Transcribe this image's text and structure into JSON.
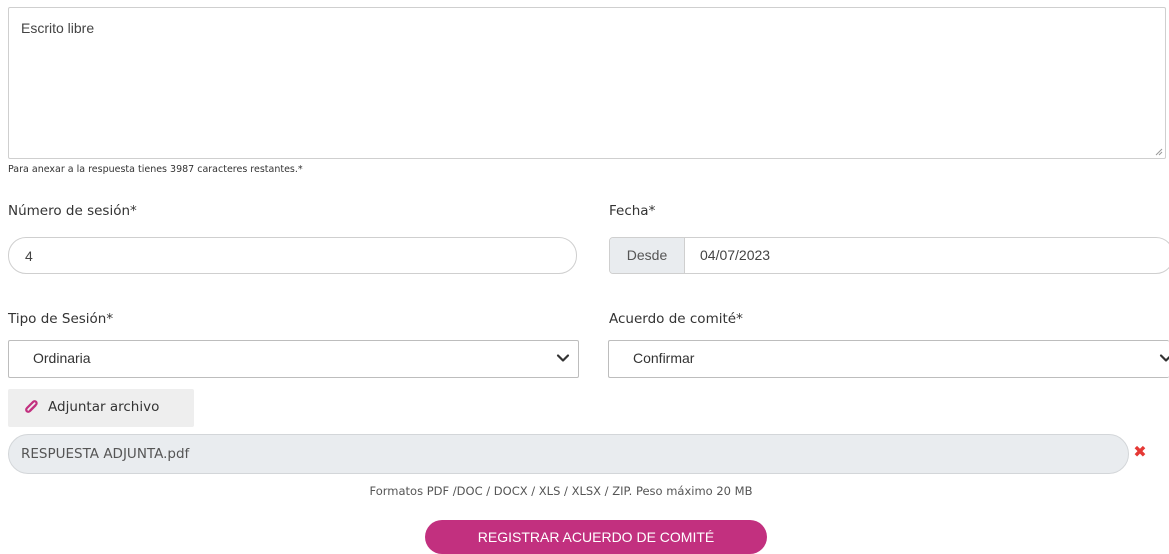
{
  "free_text": {
    "placeholder": "Escrito libre"
  },
  "chars_hint": "Para anexar a la respuesta tienes 3987 caracteres restantes.*",
  "session_number": {
    "label": "Número de sesión*",
    "value": "4"
  },
  "date": {
    "label": "Fecha*",
    "addon": "Desde",
    "value": "04/07/2023"
  },
  "session_type": {
    "label": "Tipo de Sesión*",
    "selected": "Ordinaria"
  },
  "committee_agreement": {
    "label": "Acuerdo de comité*",
    "selected": "Confirmar"
  },
  "attach": {
    "label": "Adjuntar archivo",
    "icon": "paperclip-icon"
  },
  "file": {
    "name": "RESPUESTA ADJUNTA.pdf",
    "remove_icon": "close-icon"
  },
  "formats_note": "Formatos PDF /DOC / DOCX / XLS / XLSX / ZIP. Peso máximo 20 MB",
  "submit": {
    "label": "REGISTRAR ACUERDO DE COMITÉ"
  },
  "colors": {
    "accent": "#c2307f",
    "attach_icon": "#c2307f",
    "remove_icon": "#e53935"
  }
}
